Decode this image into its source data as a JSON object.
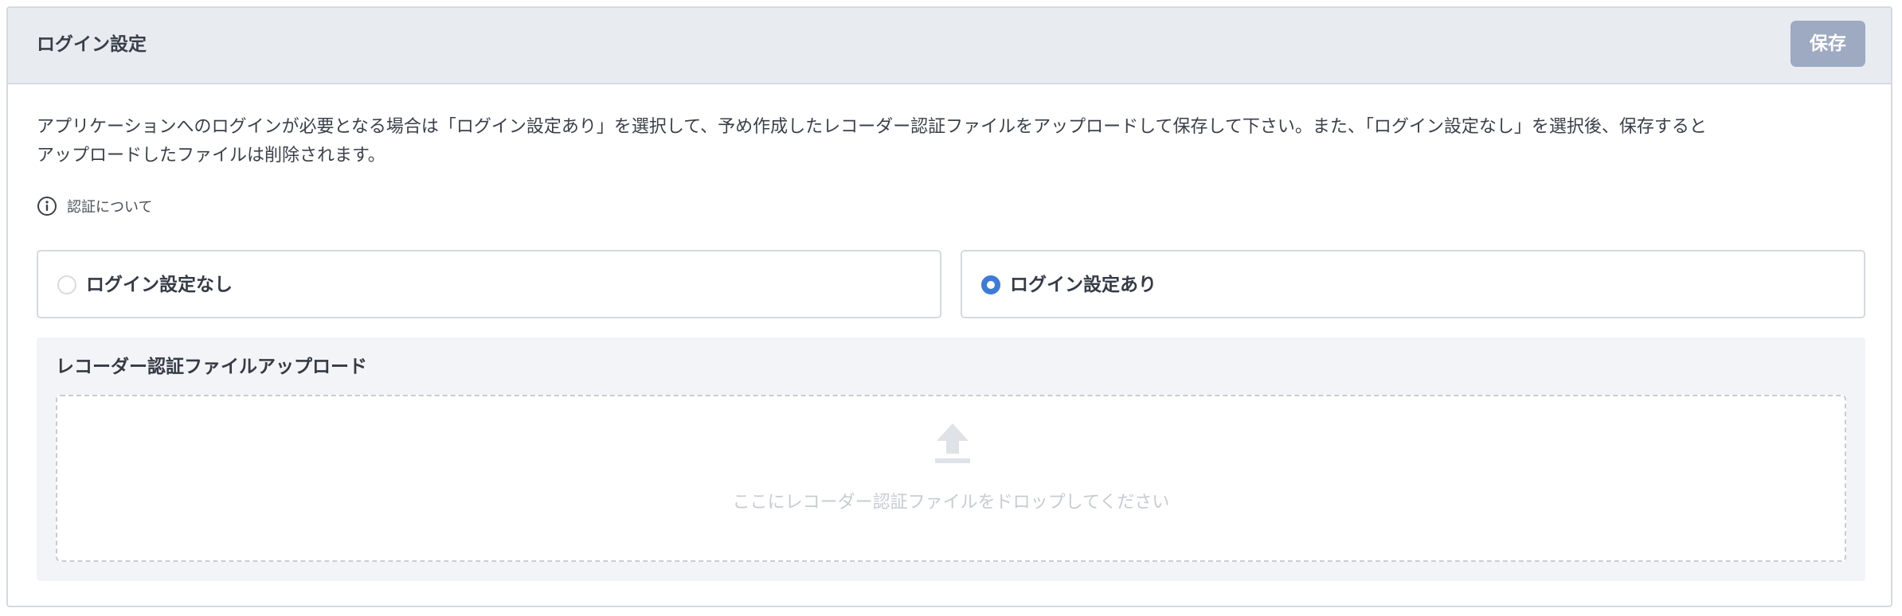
{
  "panel": {
    "title": "ログイン設定",
    "save_label": "保存"
  },
  "description": {
    "line1": "アプリケーションへのログインが必要となる場合は「ログイン設定あり」を選択して、予め作成したレコーダー認証ファイルをアップロードして保存して下さい。また、「ログイン設定なし」を選択後、保存すると",
    "line2": "アップロードしたファイルは削除されます。"
  },
  "help_link": {
    "label": "認証について",
    "icon": "info-icon"
  },
  "login_options": [
    {
      "label": "ログイン設定なし",
      "selected": false
    },
    {
      "label": "ログイン設定あり",
      "selected": true
    }
  ],
  "upload": {
    "title": "レコーダー認証ファイルアップロード",
    "drop_text": "ここにレコーダー認証ファイルをドロップしてください",
    "icon": "upload-icon"
  },
  "colors": {
    "accent": "#3d7bd6",
    "save_button": "#9eaac1",
    "header_bg": "#e8ebf0",
    "section_bg": "#f3f4f7"
  }
}
